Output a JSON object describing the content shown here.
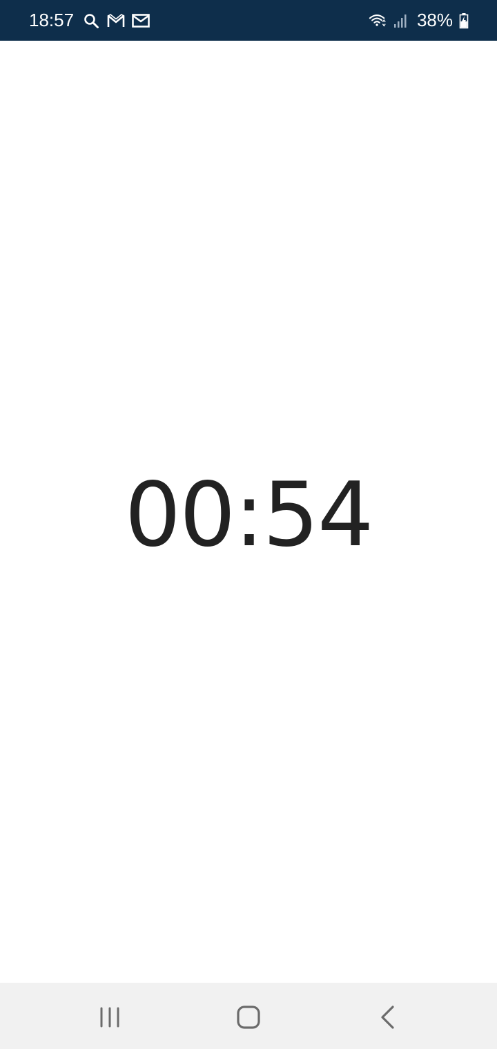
{
  "status_bar": {
    "time": "18:57",
    "left_icons": [
      "search-icon",
      "gmail-icon",
      "mail-icon"
    ],
    "right_icons": [
      "wifi-icon",
      "signal-icon"
    ],
    "battery_percent": "38%",
    "background_color": "#0e2e4b"
  },
  "main": {
    "timer_value": "00:54",
    "text_color": "#222222"
  },
  "nav_bar": {
    "buttons": [
      "recent-apps",
      "home",
      "back"
    ],
    "background_color": "#f1f1f1"
  }
}
